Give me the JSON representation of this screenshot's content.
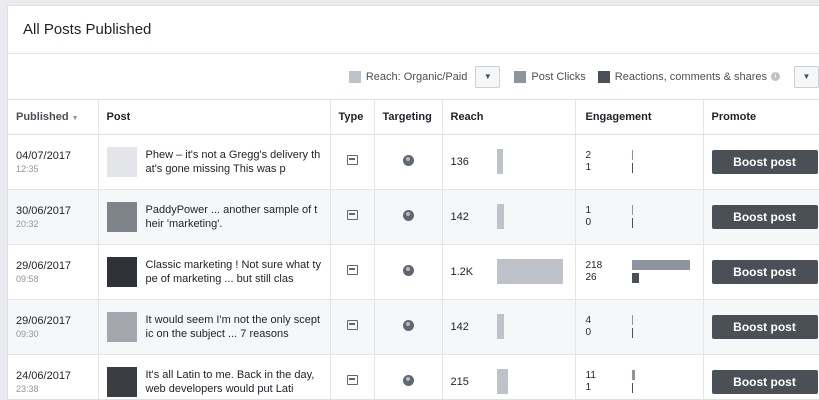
{
  "header": {
    "title": "All Posts Published"
  },
  "legend": {
    "reach_label": "Reach: Organic/Paid",
    "clicks_label": "Post Clicks",
    "reactions_label": "Reactions, comments & shares",
    "colors": {
      "reach": "#bec2c9",
      "clicks": "#8d949e",
      "reactions": "#4b4f56"
    }
  },
  "columns": {
    "published": "Published",
    "post": "Post",
    "type": "Type",
    "targeting": "Targeting",
    "reach": "Reach",
    "engagement": "Engagement",
    "promote": "Promote"
  },
  "rows": [
    {
      "date": "04/07/2017",
      "time": "12:35",
      "text": "Phew – it's not a Gregg's delivery that's gone missing This was p",
      "reach": "136",
      "reach_frac": 0.09,
      "clicks": "2",
      "reactions": "1",
      "clicks_frac": 0.009,
      "reactions_frac": 0.004,
      "boost": "Boost post",
      "thumb": "#e3e5e8"
    },
    {
      "date": "30/06/2017",
      "time": "20:32",
      "text": "PaddyPower ... another sample of their 'marketing'.",
      "reach": "142",
      "reach_frac": 0.1,
      "clicks": "1",
      "reactions": "0",
      "clicks_frac": 0.005,
      "reactions_frac": 0.0,
      "boost": "Boost post",
      "thumb": "#7f838a"
    },
    {
      "date": "29/06/2017",
      "time": "09:58",
      "text": "Classic marketing ! Not sure what type of marketing ... but still clas",
      "reach": "1.2K",
      "reach_frac": 1.0,
      "clicks": "218",
      "reactions": "26",
      "clicks_frac": 1.0,
      "reactions_frac": 0.12,
      "boost": "Boost post",
      "thumb": "#2f3238"
    },
    {
      "date": "29/06/2017",
      "time": "09:30",
      "text": "It would seem I'm not the only sceptic on the subject ... 7 reasons",
      "reach": "142",
      "reach_frac": 0.1,
      "clicks": "4",
      "reactions": "0",
      "clicks_frac": 0.018,
      "reactions_frac": 0.0,
      "boost": "Boost post",
      "thumb": "#a4a7ad"
    },
    {
      "date": "24/06/2017",
      "time": "23:38",
      "text": "It's all Latin to me. Back in the day, web developers would put Lati",
      "reach": "215",
      "reach_frac": 0.17,
      "clicks": "11",
      "reactions": "1",
      "clicks_frac": 0.05,
      "reactions_frac": 0.004,
      "boost": "Boost post",
      "thumb": "#3a3d42"
    }
  ]
}
